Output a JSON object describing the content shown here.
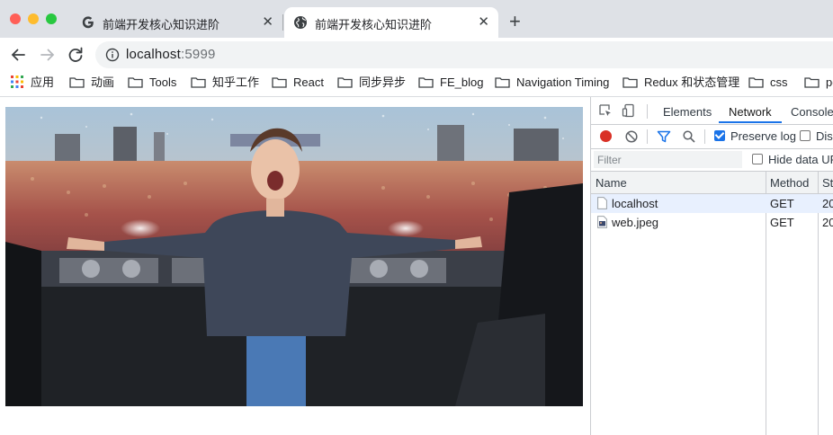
{
  "tabs": [
    {
      "title": "前端开发核心知识进阶",
      "close": "✕",
      "favicon": "google-g-icon"
    },
    {
      "title": "前端开发核心知识进阶",
      "close": "✕",
      "favicon": "globe-icon"
    }
  ],
  "new_tab": "+",
  "address": {
    "host": "localhost",
    "port": ":5999"
  },
  "bookmarks": {
    "apps": "应用",
    "items": [
      "动画",
      "Tools",
      "知乎工作",
      "React",
      "同步异步",
      "FE_blog",
      "Navigation Timing",
      "Redux 和状态管理",
      "css",
      "pe"
    ]
  },
  "devtools": {
    "tabs": [
      "Elements",
      "Network",
      "Console"
    ],
    "selected_tab": "Network",
    "preserve_log": {
      "label": "Preserve log",
      "checked": true
    },
    "disable_cache": {
      "label": "Disa",
      "checked": false
    },
    "filter_placeholder": "Filter",
    "hide_data_urls": {
      "label": "Hide data UR",
      "checked": false
    },
    "columns": [
      "Name",
      "Method",
      "St"
    ],
    "rows": [
      {
        "name": "localhost",
        "method": "GET",
        "status": "20"
      },
      {
        "name": "web.jpeg",
        "method": "GET",
        "status": "20"
      }
    ]
  },
  "colors": {
    "accent": "#1a73e8",
    "record": "#d93025",
    "row_selected": "#e8f0fe"
  }
}
